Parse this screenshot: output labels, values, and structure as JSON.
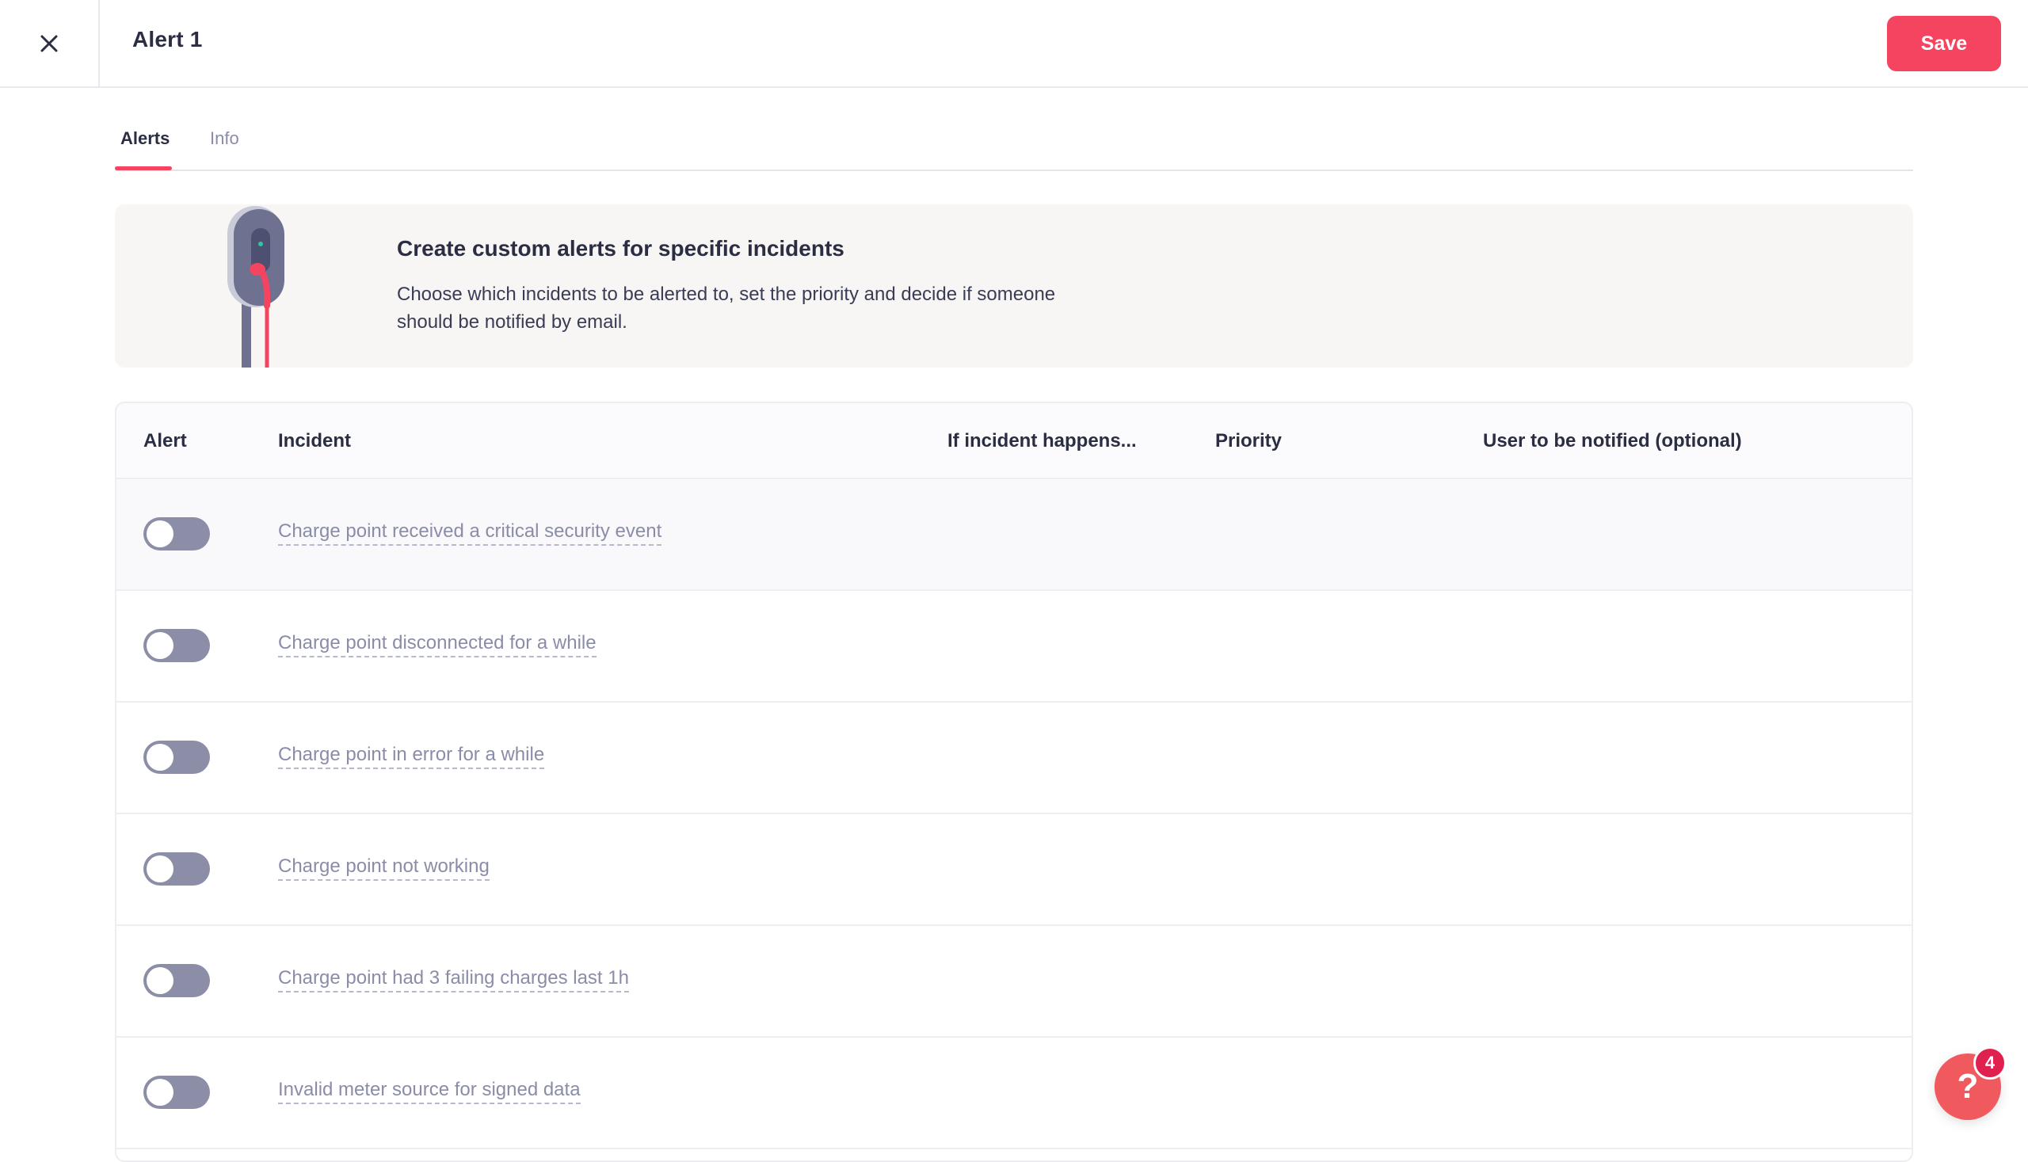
{
  "header": {
    "title": "Alert 1",
    "save_label": "Save",
    "close_icon": "close-icon"
  },
  "tabs": [
    {
      "label": "Alerts",
      "active": true
    },
    {
      "label": "Info",
      "active": false
    }
  ],
  "banner": {
    "title": "Create custom alerts for specific incidents",
    "text_line1": "Choose which incidents to be alerted to, set the priority and decide if someone",
    "text_line2": "should be notified by email."
  },
  "table": {
    "columns": [
      "Alert",
      "Incident",
      "If incident happens...",
      "Priority",
      "User to be notified (optional)"
    ],
    "rows": [
      {
        "enabled": false,
        "incident": "Charge point received a critical security event"
      },
      {
        "enabled": false,
        "incident": "Charge point disconnected for a while"
      },
      {
        "enabled": false,
        "incident": "Charge point in error for a while"
      },
      {
        "enabled": false,
        "incident": "Charge point not working"
      },
      {
        "enabled": false,
        "incident": "Charge point had 3 failing charges last 1h"
      },
      {
        "enabled": false,
        "incident": "Invalid meter source for signed data"
      }
    ]
  },
  "help": {
    "icon": "question-icon",
    "badge_count": "4"
  },
  "colors": {
    "accent": "#f44460",
    "toggle_off": "#8c8ea8",
    "muted_text": "#8a8ca8",
    "banner_bg": "#f7f6f5"
  }
}
